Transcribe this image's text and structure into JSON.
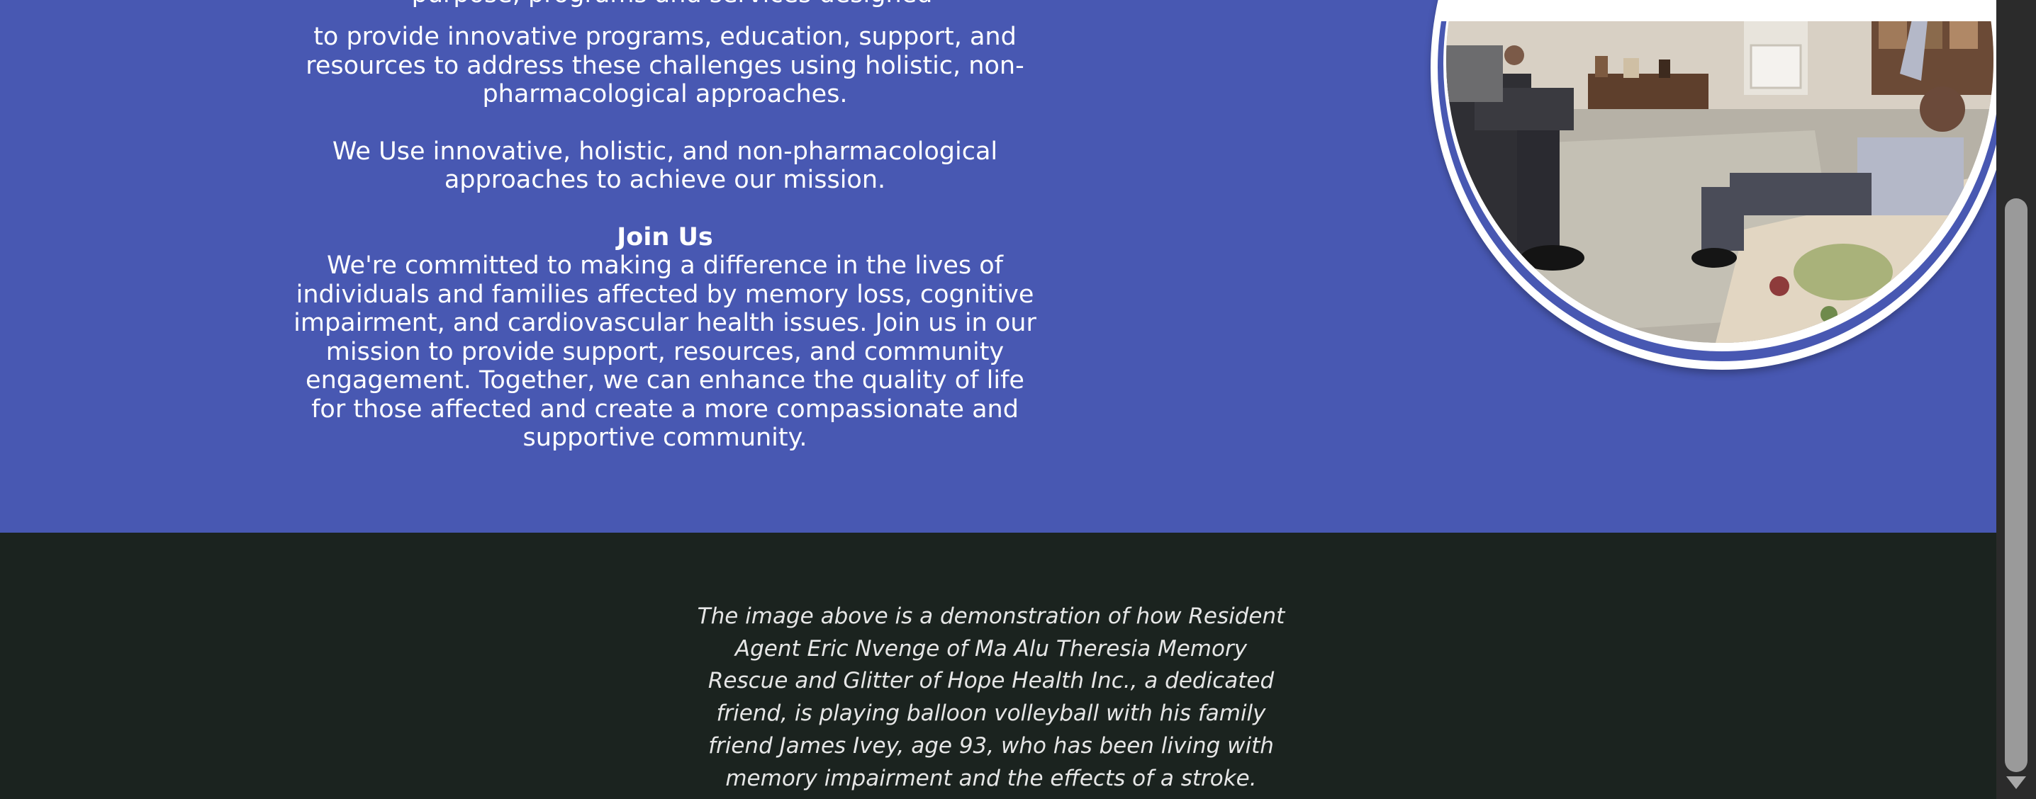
{
  "about": {
    "cut_text": "purpose, programs and services designed",
    "paragraph_1": "to provide innovative programs, education, support, and resources to address these challenges using holistic, non-pharmacological approaches.",
    "paragraph_2": "We Use innovative, holistic, and non-pharmacological approaches to achieve our mission.",
    "join_title": "Join Us",
    "join_text": "We're committed to making a difference in the lives of individuals and families affected by memory loss, cognitive impairment, and cardiovascular health issues. Join us in our mission to provide support, resources, and community engagement. Together, we can enhance the quality of life for those affected and create a more compassionate and supportive community."
  },
  "photo": {
    "subject": "balloon-volleyball-photo"
  },
  "caption": {
    "text": "The image above is a demonstration of how Resident Agent Eric Nvenge of Ma Alu Theresia Memory Rescue and Glitter of Hope Health Inc., a dedicated friend, is playing balloon volleyball with his family friend James Ivey, age 93, who has been living with memory impairment and the effects of a stroke."
  },
  "colors": {
    "section_blue": "#4858b2",
    "section_dark": "#1b231f",
    "text_light": "#ffffff",
    "caption_text": "#e6e6e6"
  }
}
